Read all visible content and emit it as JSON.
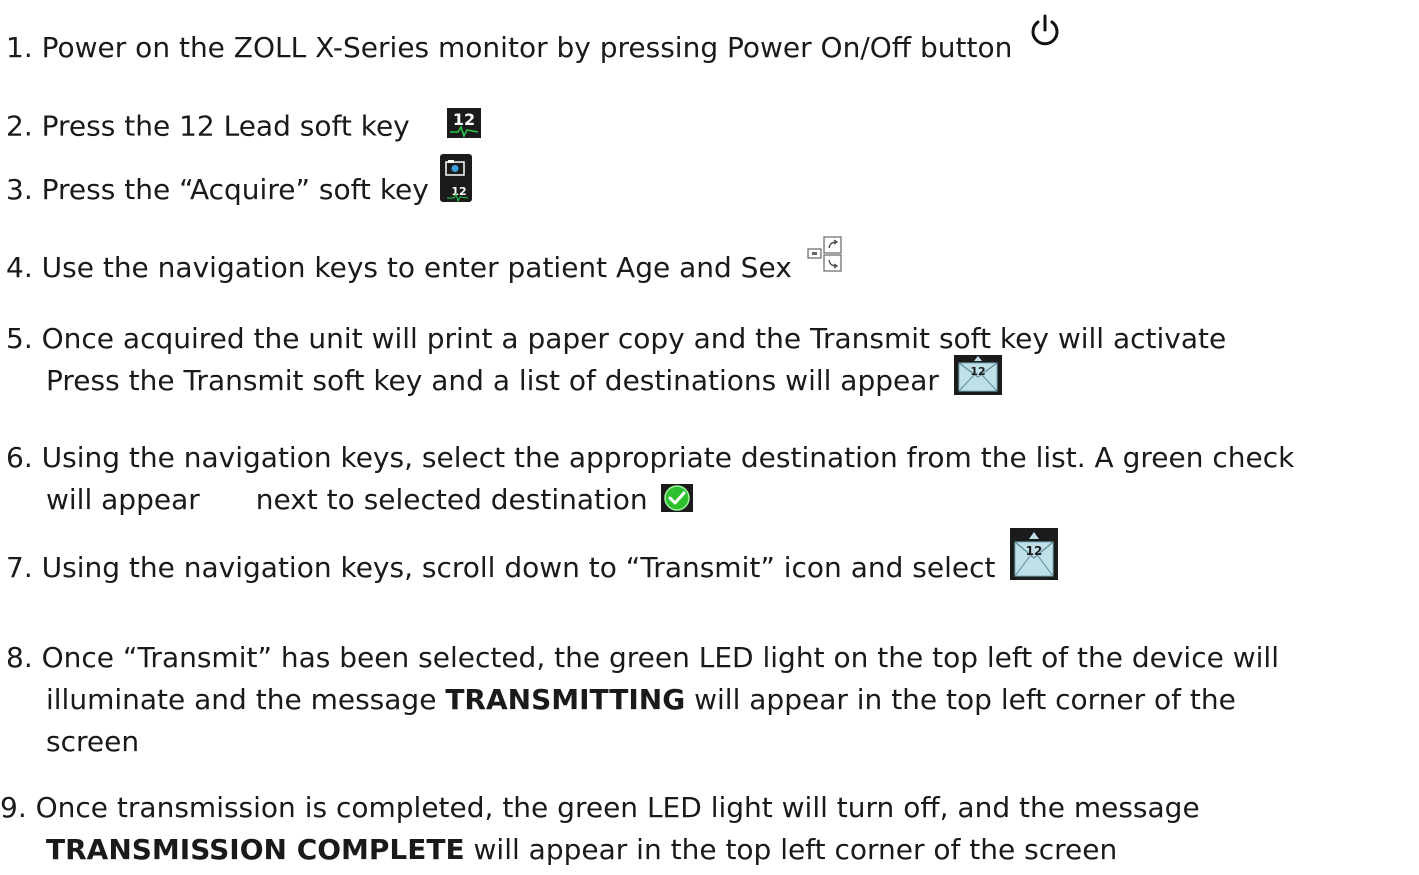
{
  "steps": [
    {
      "num": "1.",
      "text": "Power on the ZOLL X-Series monitor by pressing Power On/Off button",
      "icon": "power-icon"
    },
    {
      "num": "2.",
      "text": "Press the 12 Lead soft key",
      "icon": "12-lead-icon",
      "icon_label": "12"
    },
    {
      "num": "3.",
      "text": "Press the “Acquire” soft key",
      "icon": "acquire-camera-icon",
      "icon_label": "12"
    },
    {
      "num": "4.",
      "text": "Use the navigation keys to enter patient Age and Sex",
      "icon": "navigation-keys-icon"
    },
    {
      "num": "5.",
      "text": "Once acquired the unit will print a paper copy and the Transmit soft key will activate",
      "text2": "Press the Transmit soft key and a list of destinations will appear",
      "icon": "transmit-envelope-icon",
      "icon_label": "12"
    },
    {
      "num": "6.",
      "text": "Using the navigation keys, select the appropriate destination from the list.  A green check",
      "text2a": "will appear",
      "text2b": "next to selected destination",
      "icon": "green-check-icon"
    },
    {
      "num": "7.",
      "text": "Using the navigation keys, scroll down to “Transmit” icon and select",
      "icon": "transmit-envelope-icon",
      "icon_label": "12"
    },
    {
      "num": "8.",
      "text": "Once “Transmit” has been selected, the green LED light on the top left of the device will",
      "text2a": "illuminate and the message",
      "bold": "TRANSMITTING",
      "text2b": "will appear in the top left corner of the",
      "text3": "screen"
    },
    {
      "num": "9.",
      "text": "Once transmission is completed, the green LED light will turn off, and the message",
      "bold": "TRANSMISSION COMPLETE",
      "text2b": "will appear in the top left corner of the screen"
    }
  ]
}
